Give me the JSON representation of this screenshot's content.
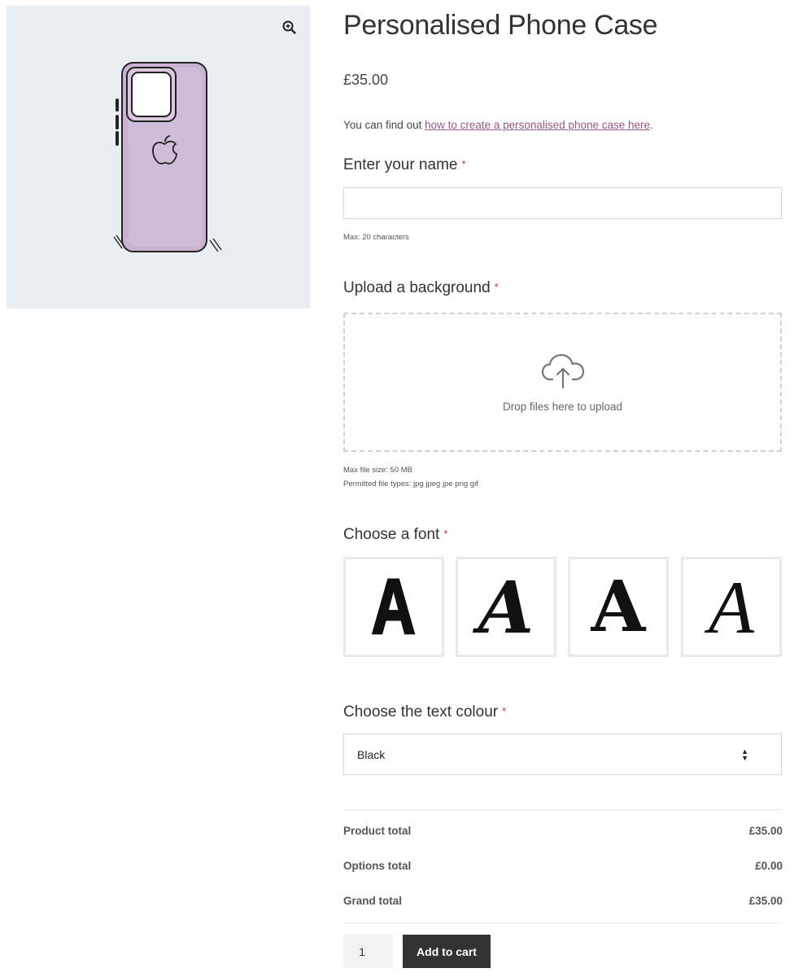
{
  "product": {
    "title": "Personalised Phone Case",
    "price": "£35.00",
    "description_prefix": "You can find out ",
    "description_link": "how to create a personalised phone case here",
    "description_suffix": "."
  },
  "gallery": {
    "zoom_icon": "zoom-in-icon",
    "image": "phone-case-illustration"
  },
  "fields": {
    "name": {
      "label": "Enter your name",
      "required_mark": "*",
      "value": "",
      "hint": "Max: 20 characters"
    },
    "background": {
      "label": "Upload a background",
      "required_mark": "*",
      "drop_text": "Drop files here to upload",
      "icon": "cloud-upload-icon",
      "max_size": "Max file size: 50 MB",
      "types": "Permitted file types: jpg jpeg jpe png gif"
    },
    "font": {
      "label": "Choose a font",
      "required_mark": "*",
      "options": [
        "A",
        "A",
        "A",
        "A"
      ]
    },
    "colour": {
      "label": "Choose the text colour",
      "required_mark": "*",
      "selected": "Black",
      "arrow": "▲▼"
    }
  },
  "totals": {
    "product_label": "Product total",
    "product_value": "£35.00",
    "options_label": "Options total",
    "options_value": "£0.00",
    "grand_label": "Grand total",
    "grand_value": "£35.00"
  },
  "cart": {
    "quantity": "1",
    "button_label": "Add to cart",
    "button_color": "#333333"
  },
  "colors": {
    "link": "#96588a",
    "required": "#c0392b",
    "gallery_bg": "#e8eef1",
    "phone_case": "#c9b3d0"
  }
}
